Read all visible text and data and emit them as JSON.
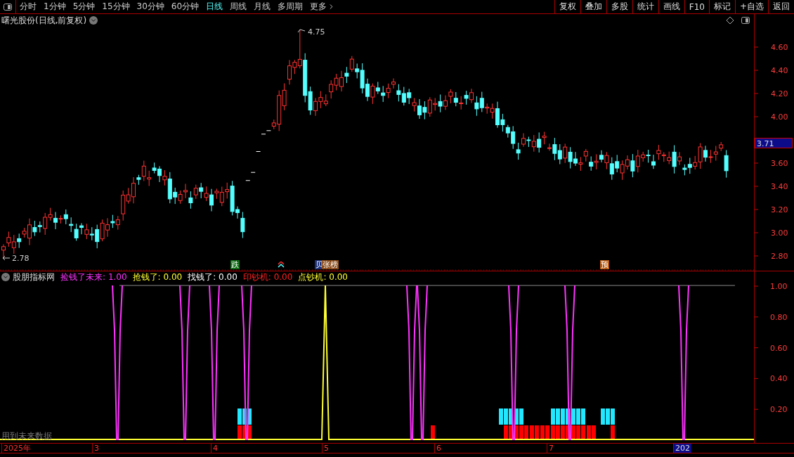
{
  "toolbar": {
    "periods": [
      {
        "label": "分时",
        "selected": false
      },
      {
        "label": "1分钟",
        "selected": false
      },
      {
        "label": "5分钟",
        "selected": false
      },
      {
        "label": "15分钟",
        "selected": false
      },
      {
        "label": "30分钟",
        "selected": false
      },
      {
        "label": "60分钟",
        "selected": false
      },
      {
        "label": "日线",
        "selected": true
      },
      {
        "label": "周线",
        "selected": false
      },
      {
        "label": "月线",
        "selected": false
      },
      {
        "label": "多周期",
        "selected": false
      },
      {
        "label": "更多",
        "selected": false
      }
    ],
    "actions": [
      "复权",
      "叠加",
      "多股",
      "统计",
      "画线",
      "F10",
      "标记",
      "+自选",
      "返回"
    ]
  },
  "chart": {
    "title": "曙光股份(日线,前复权)",
    "high_label": "4.75",
    "low_label": "2.78",
    "current_price": "3.71",
    "price_axis": [
      "4.60",
      "4.40",
      "4.20",
      "4.00",
      "3.60",
      "3.40",
      "3.20",
      "3.00",
      "2.80"
    ],
    "signals": [
      {
        "kind": "badge",
        "text": "跌",
        "color": "#0f6b14"
      },
      {
        "kind": "arrow"
      },
      {
        "kind": "badge",
        "text": "贝",
        "color": "#1b2f7a"
      },
      {
        "kind": "badge",
        "text": "张榜",
        "color": "#8a4a1a"
      },
      {
        "kind": "badge",
        "text": "预",
        "color": "#b85a10"
      }
    ]
  },
  "indicator": {
    "name": "股朋指标网",
    "note": "用到未来数据",
    "series": [
      {
        "name": "捡钱了未来:",
        "value": "1.00",
        "color": "#ff33ff"
      },
      {
        "name": "抢钱了:",
        "value": "0.00",
        "color": "#ffff33"
      },
      {
        "name": "找钱了:",
        "value": "0.00",
        "color": "#ffffff"
      },
      {
        "name": "印钞机:",
        "value": "0.00",
        "color": "#ff2020"
      },
      {
        "name": "点钞机:",
        "value": "0.00",
        "color": "#ffff33"
      }
    ],
    "axis": [
      "1.00",
      "0.80",
      "0.60",
      "0.40",
      "0.20"
    ]
  },
  "date_axis": [
    {
      "label": "2025年",
      "selected": false
    },
    {
      "label": "3",
      "selected": false
    },
    {
      "label": "4",
      "selected": false
    },
    {
      "label": "5",
      "selected": false
    },
    {
      "label": "6",
      "selected": false
    },
    {
      "label": "7",
      "selected": false
    },
    {
      "label": "202",
      "selected": true
    }
  ]
}
